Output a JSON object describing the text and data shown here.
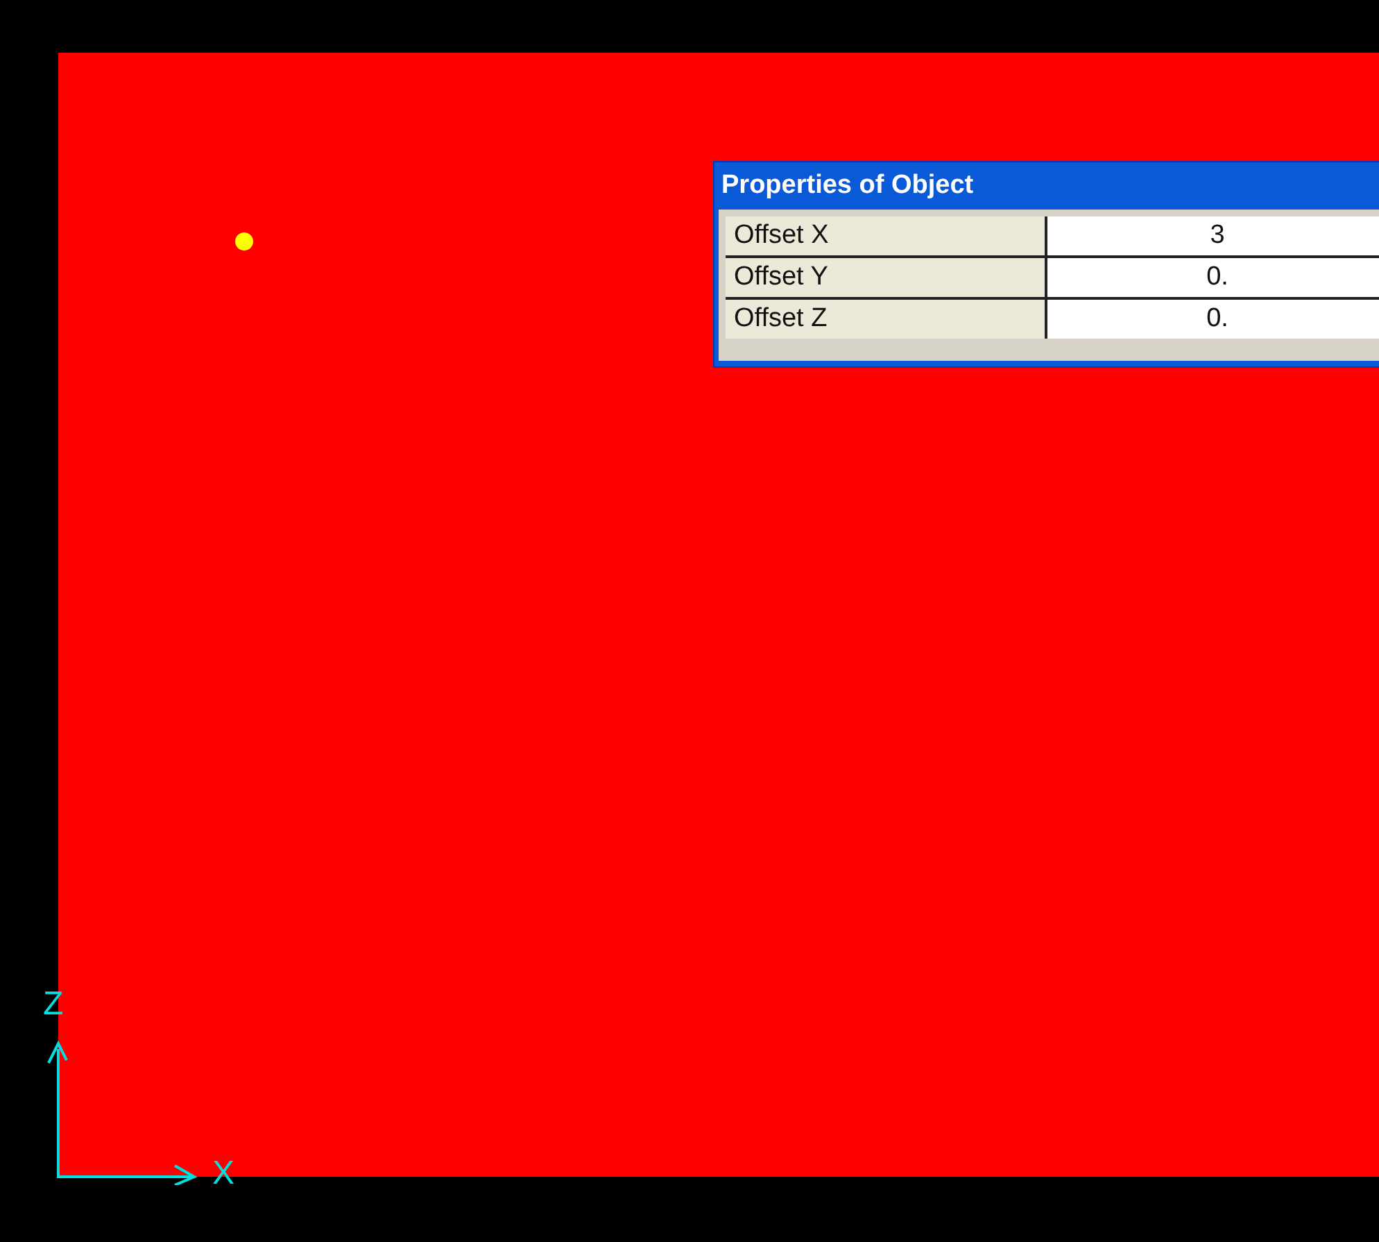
{
  "viewport": {
    "axes": {
      "vertical_label": "Z",
      "horizontal_label": "X"
    },
    "properties_panel": {
      "title": "Properties of Object",
      "rows": [
        {
          "label": "Offset X",
          "value": "3"
        },
        {
          "label": "Offset Y",
          "value": "0."
        },
        {
          "label": "Offset Z",
          "value": "0."
        }
      ]
    }
  }
}
